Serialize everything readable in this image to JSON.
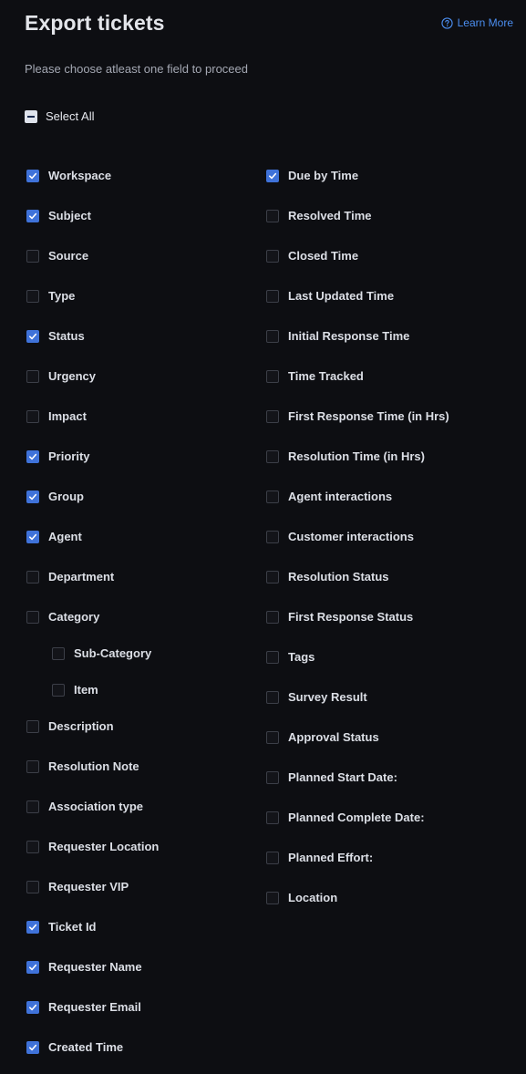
{
  "header": {
    "title": "Export tickets",
    "learn_more": "Learn More",
    "subtitle": "Please choose atleast one field to proceed"
  },
  "select_all": {
    "label": "Select All",
    "state": "indeterminate"
  },
  "colors": {
    "accent": "#3f72d9",
    "link": "#4b8ef0",
    "background": "#0d0e12"
  },
  "left_fields": [
    {
      "label": "Workspace",
      "checked": true
    },
    {
      "label": "Subject",
      "checked": true
    },
    {
      "label": "Source",
      "checked": false
    },
    {
      "label": "Type",
      "checked": false
    },
    {
      "label": "Status",
      "checked": true
    },
    {
      "label": "Urgency",
      "checked": false
    },
    {
      "label": "Impact",
      "checked": false
    },
    {
      "label": "Priority",
      "checked": true
    },
    {
      "label": "Group",
      "checked": true
    },
    {
      "label": "Agent",
      "checked": true
    },
    {
      "label": "Department",
      "checked": false
    },
    {
      "label": "Category",
      "checked": false
    },
    {
      "label": "Sub-Category",
      "checked": false,
      "nested": true
    },
    {
      "label": "Item",
      "checked": false,
      "nested": true
    },
    {
      "label": "Description",
      "checked": false
    },
    {
      "label": "Resolution Note",
      "checked": false
    },
    {
      "label": "Association type",
      "checked": false
    },
    {
      "label": "Requester Location",
      "checked": false
    },
    {
      "label": "Requester VIP",
      "checked": false
    },
    {
      "label": "Ticket Id",
      "checked": true
    },
    {
      "label": "Requester Name",
      "checked": true
    },
    {
      "label": "Requester Email",
      "checked": true
    },
    {
      "label": "Created Time",
      "checked": true
    }
  ],
  "right_fields": [
    {
      "label": "Due by Time",
      "checked": true
    },
    {
      "label": "Resolved Time",
      "checked": false
    },
    {
      "label": "Closed Time",
      "checked": false
    },
    {
      "label": "Last Updated Time",
      "checked": false
    },
    {
      "label": "Initial Response Time",
      "checked": false
    },
    {
      "label": "Time Tracked",
      "checked": false
    },
    {
      "label": "First Response Time (in Hrs)",
      "checked": false
    },
    {
      "label": "Resolution Time (in Hrs)",
      "checked": false
    },
    {
      "label": "Agent interactions",
      "checked": false
    },
    {
      "label": "Customer interactions",
      "checked": false
    },
    {
      "label": "Resolution Status",
      "checked": false
    },
    {
      "label": "First Response Status",
      "checked": false
    },
    {
      "label": "Tags",
      "checked": false
    },
    {
      "label": "Survey Result",
      "checked": false
    },
    {
      "label": "Approval Status",
      "checked": false
    },
    {
      "label": "Planned Start Date:",
      "checked": false
    },
    {
      "label": "Planned Complete Date:",
      "checked": false
    },
    {
      "label": "Planned Effort:",
      "checked": false
    },
    {
      "label": "Location",
      "checked": false
    }
  ]
}
